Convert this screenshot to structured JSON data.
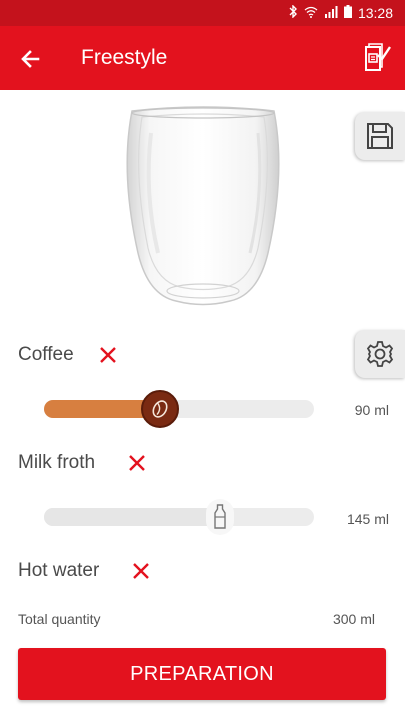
{
  "status_bar": {
    "time": "13:28",
    "icons": [
      "bluetooth-icon",
      "wifi-icon",
      "signal-icon",
      "battery-icon"
    ]
  },
  "app_bar": {
    "title": "Freestyle",
    "back_icon": "arrow-left-icon",
    "recipe_icon": "recipe-book-icon",
    "background": "#e3121e"
  },
  "side_buttons": {
    "save_icon": "floppy-disk-icon",
    "settings_icon": "gear-icon"
  },
  "ingredients": {
    "coffee": {
      "label": "Coffee",
      "amount": "90 ml",
      "level": 0.43,
      "fill_color": "#d77f40",
      "knob_color": "#7a2a12"
    },
    "milk": {
      "label": "Milk froth",
      "amount": "145 ml",
      "level": 0.65
    },
    "water": {
      "label": "Hot water"
    }
  },
  "total": {
    "label": "Total quantity",
    "value": "300 ml"
  },
  "preparation_button": {
    "label": "PREPARATION"
  },
  "colors": {
    "accent": "#e3121e",
    "remove": "#e3121e"
  }
}
